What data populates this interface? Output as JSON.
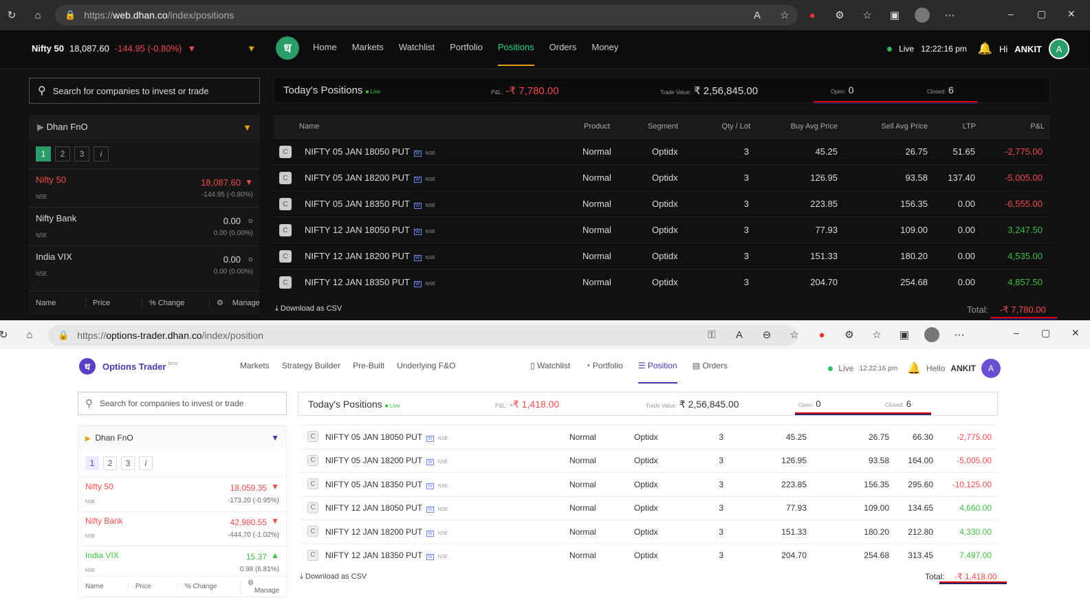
{
  "top": {
    "url_prefix": "https://",
    "url_host": "web.dhan.co",
    "url_path": "/index/positions",
    "ticker": {
      "name": "Nifty 50",
      "price": "18,087.60",
      "change": "-144.95 (-0.80%)"
    },
    "logo": "ध",
    "menu": [
      "Home",
      "Markets",
      "Watchlist",
      "Portfolio",
      "Positions",
      "Orders",
      "Money"
    ],
    "live": "Live",
    "time": "12:22:16 pm",
    "greeting": "Hi",
    "user": "ANKIT",
    "avatar": "A",
    "search_placeholder": "Search for companies to invest or trade",
    "watchlist": {
      "title": "Dhan FnO",
      "tabs": [
        "1",
        "2",
        "3",
        "i"
      ],
      "rows": [
        {
          "name": "Nifty 50",
          "exch": "NSE",
          "price": "18,087.60",
          "change": "-144.95 (-0.80%)"
        },
        {
          "name": "Nifty Bank",
          "exch": "NSE",
          "price": "0.00",
          "change": "0.00 (0.00%)"
        },
        {
          "name": "India VIX",
          "exch": "NSE",
          "price": "0.00",
          "change": "0.00 (0.00%)"
        }
      ],
      "footer": [
        "Name",
        "Price",
        "% Change",
        "Manage"
      ]
    },
    "summary": {
      "title": "Today's Positions",
      "live": "Live",
      "pnl_label": "P&L:",
      "pnl": "-₹ 7,780.00",
      "tv_label": "Trade Value:",
      "tv": "₹ 2,56,845.00",
      "open_label": "Open:",
      "open": "0",
      "closed_label": "Closed:",
      "closed": "6"
    },
    "columns": [
      "Name",
      "Product",
      "Segment",
      "Qty / Lot",
      "Buy Avg Price",
      "Sell Avg Price",
      "LTP",
      "P&L"
    ],
    "rows": [
      {
        "name": "NIFTY 05 JAN 18050 PUT",
        "product": "Normal",
        "segment": "Optidx",
        "qty": "3",
        "buy": "45.25",
        "sell": "26.75",
        "ltp": "51.65",
        "pnl": "-2,775.00"
      },
      {
        "name": "NIFTY 05 JAN 18200 PUT",
        "product": "Normal",
        "segment": "Optidx",
        "qty": "3",
        "buy": "126.95",
        "sell": "93.58",
        "ltp": "137.40",
        "pnl": "-5,005.00"
      },
      {
        "name": "NIFTY 05 JAN 18350 PUT",
        "product": "Normal",
        "segment": "Optidx",
        "qty": "3",
        "buy": "223.85",
        "sell": "156.35",
        "ltp": "0.00",
        "pnl": "-6,555.00"
      },
      {
        "name": "NIFTY 12 JAN 18050 PUT",
        "product": "Normal",
        "segment": "Optidx",
        "qty": "3",
        "buy": "77.93",
        "sell": "109.00",
        "ltp": "0.00",
        "pnl": "3,247.50"
      },
      {
        "name": "NIFTY 12 JAN 18200 PUT",
        "product": "Normal",
        "segment": "Optidx",
        "qty": "3",
        "buy": "151.33",
        "sell": "180.20",
        "ltp": "0.00",
        "pnl": "4,535.00"
      },
      {
        "name": "NIFTY 12 JAN 18350 PUT",
        "product": "Normal",
        "segment": "Optidx",
        "qty": "3",
        "buy": "204.70",
        "sell": "254.68",
        "ltp": "0.00",
        "pnl": "4,857.50"
      }
    ],
    "download": "Download as CSV",
    "total_label": "Total:",
    "total": "-₹ 7,780.00"
  },
  "bot": {
    "url_prefix": "https://",
    "url_host": "options-trader.dhan.co",
    "url_path": "/index/position",
    "logo": "ध",
    "app": "Options Trader",
    "beta": "beta",
    "menu": [
      "Markets",
      "Strategy Builder",
      "Pre-Built",
      "Underlying F&O"
    ],
    "menu2": [
      "Watchlist",
      "Portfolio",
      "Position",
      "Orders"
    ],
    "live": "Live",
    "time": "12:22:16 pm",
    "greeting": "Hello",
    "user": "ANKIT",
    "avatar": "A",
    "search_placeholder": "Search for companies to invest or trade",
    "watchlist": {
      "title": "Dhan FnO",
      "tabs": [
        "1",
        "2",
        "3",
        "i"
      ],
      "rows": [
        {
          "name": "Nifty 50",
          "exch": "NSE",
          "price": "18,059.35",
          "change": "-173.20 (-0.95%)"
        },
        {
          "name": "Nifty Bank",
          "exch": "NSE",
          "price": "42,980.55",
          "change": "-444.70 (-1.02%)"
        },
        {
          "name": "India VIX",
          "exch": "NSE",
          "price": "15.37",
          "change": "0.98 (6.81%)"
        }
      ],
      "footer": [
        "Name",
        "Price",
        "% Change",
        "Manage"
      ]
    },
    "summary": {
      "title": "Today's Positions",
      "live": "Live",
      "pnl_label": "P&L:",
      "pnl": "-₹ 1,418.00",
      "tv_label": "Trade Value:",
      "tv": "₹ 2,56,845.00",
      "open_label": "Open:",
      "open": "0",
      "closed_label": "Closed:",
      "closed": "6"
    },
    "rows": [
      {
        "name": "NIFTY 05 JAN 18050 PUT",
        "product": "Normal",
        "segment": "Optidx",
        "qty": "3",
        "buy": "45.25",
        "sell": "26.75",
        "ltp": "66.30",
        "pnl": "-2,775.00"
      },
      {
        "name": "NIFTY 05 JAN 18200 PUT",
        "product": "Normal",
        "segment": "Optidx",
        "qty": "3",
        "buy": "126.95",
        "sell": "93.58",
        "ltp": "164.00",
        "pnl": "-5,005.00"
      },
      {
        "name": "NIFTY 05 JAN 18350 PUT",
        "product": "Normal",
        "segment": "Optidx",
        "qty": "3",
        "buy": "223.85",
        "sell": "156.35",
        "ltp": "295.60",
        "pnl": "-10,125.00"
      },
      {
        "name": "NIFTY 12 JAN 18050 PUT",
        "product": "Normal",
        "segment": "Optidx",
        "qty": "3",
        "buy": "77.93",
        "sell": "109.00",
        "ltp": "134.65",
        "pnl": "4,660.00"
      },
      {
        "name": "NIFTY 12 JAN 18200 PUT",
        "product": "Normal",
        "segment": "Optidx",
        "qty": "3",
        "buy": "151.33",
        "sell": "180.20",
        "ltp": "212.80",
        "pnl": "4,330.00"
      },
      {
        "name": "NIFTY 12 JAN 18350 PUT",
        "product": "Normal",
        "segment": "Optidx",
        "qty": "3",
        "buy": "204.70",
        "sell": "254.68",
        "ltp": "313.45",
        "pnl": "7,497.00"
      }
    ],
    "download": "Download as CSV",
    "total_label": "Total:",
    "total": "-₹ 1,418.00"
  },
  "tags": {
    "w": "W",
    "exch": "NSE",
    "c": "C"
  },
  "colors": {
    "dhan_green": "#2a9d6a",
    "loss": "#f04b4b",
    "profit": "#3fbf3f",
    "options_purple": "#5c3fc0",
    "highlight": "#dd0000"
  }
}
